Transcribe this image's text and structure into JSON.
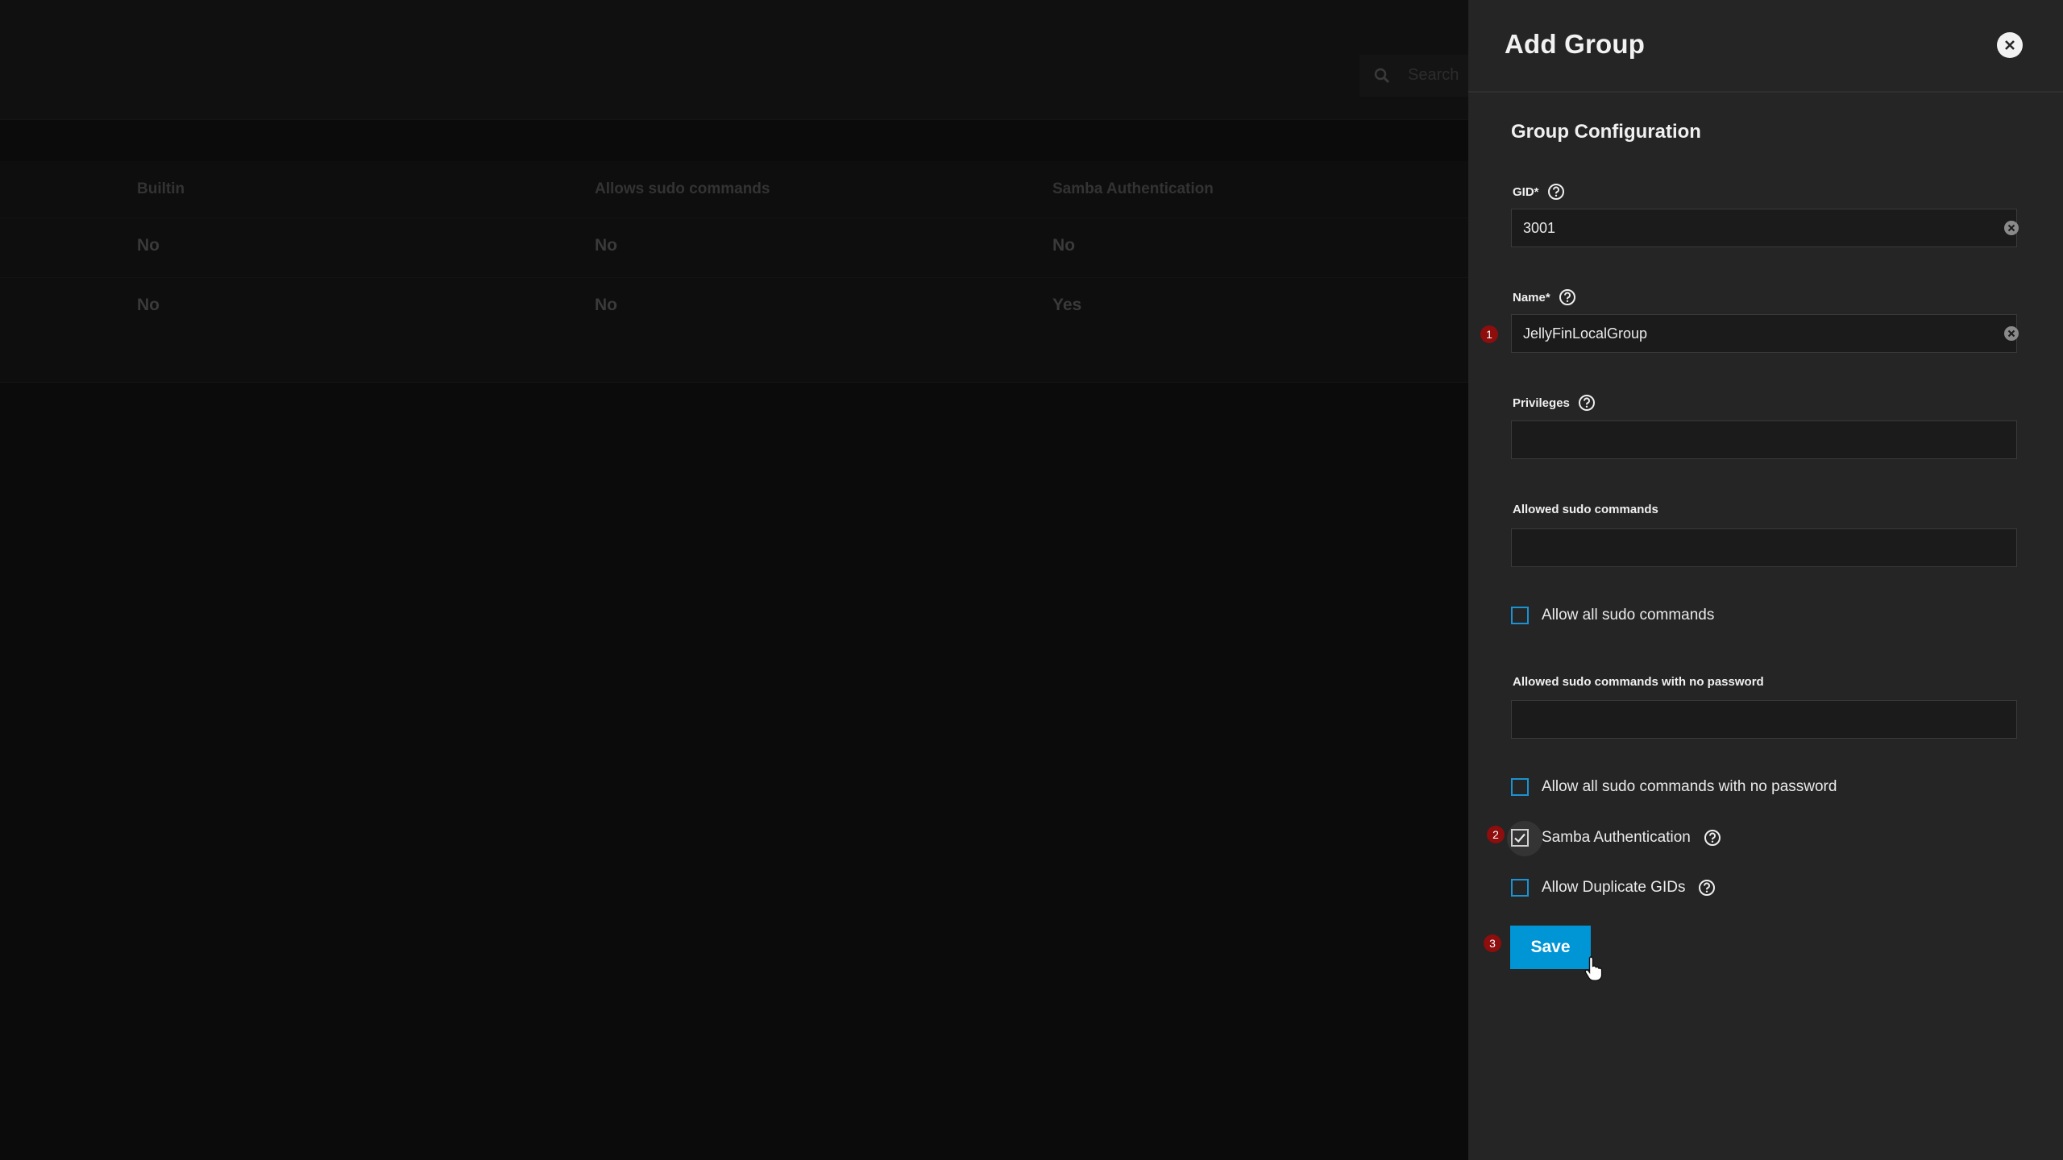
{
  "background": {
    "search_placeholder": "Search",
    "table": {
      "headers": [
        "Builtin",
        "Allows sudo commands",
        "Samba Authentication"
      ],
      "rows": [
        [
          "No",
          "No",
          "No"
        ],
        [
          "No",
          "No",
          "Yes"
        ]
      ]
    }
  },
  "panel": {
    "title": "Add Group",
    "section_title": "Group Configuration",
    "fields": {
      "gid": {
        "label": "GID*",
        "value": "3001"
      },
      "name": {
        "label": "Name*",
        "value": "JellyFinLocalGroup"
      },
      "privileges": {
        "label": "Privileges",
        "value": ""
      },
      "sudo_commands": {
        "label": "Allowed sudo commands",
        "value": ""
      },
      "sudo_nopasswd": {
        "label": "Allowed sudo commands with no password",
        "value": ""
      }
    },
    "checkboxes": {
      "allow_all_sudo": {
        "label": "Allow all sudo commands",
        "checked": false
      },
      "allow_all_sudo_nopasswd": {
        "label": "Allow all sudo commands with no password",
        "checked": false
      },
      "samba_auth": {
        "label": "Samba Authentication",
        "checked": true
      },
      "allow_duplicate_gids": {
        "label": "Allow Duplicate GIDs",
        "checked": false
      }
    },
    "save_label": "Save"
  },
  "annotations": {
    "step1": "1",
    "step2": "2",
    "step3": "3"
  },
  "colors": {
    "accent": "#0095d5",
    "checkbox_border": "#1c92d2",
    "badge": "#8e0d0d",
    "panel_bg": "#252525"
  }
}
